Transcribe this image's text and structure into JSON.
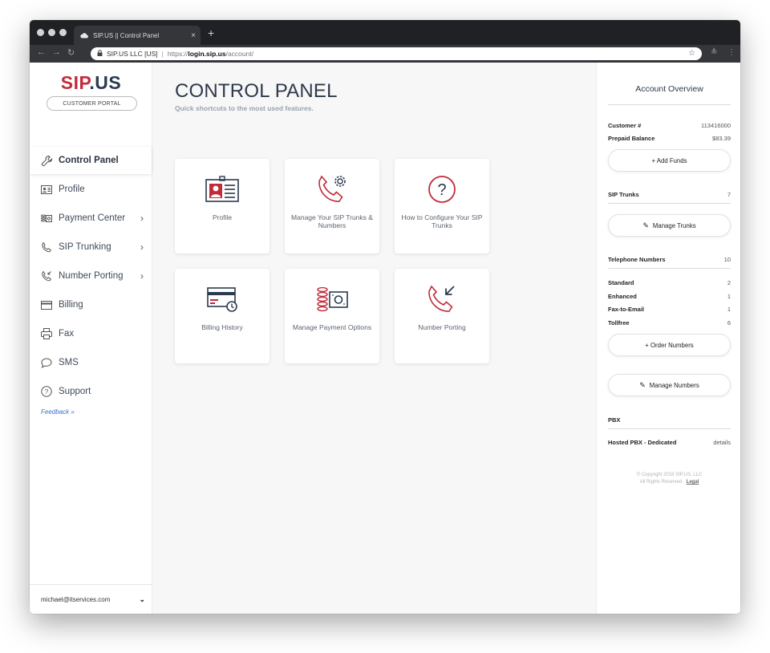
{
  "browser": {
    "tab_title": "SIP.US || Control Panel",
    "tab_close": "×",
    "new_tab": "+",
    "org": "SIP.US LLC [US]",
    "scheme": "https://",
    "host": "login.sip.us",
    "path": "/account/",
    "star": "☆"
  },
  "logo": {
    "part1": "SIP",
    "part2": ".US"
  },
  "portal_label": "CUSTOMER PORTAL",
  "sidebar": {
    "items": [
      {
        "label": "Control Panel",
        "icon": "wrench-icon",
        "active": true,
        "chevron": ""
      },
      {
        "label": "Profile",
        "icon": "id-card-icon",
        "active": false,
        "chevron": ""
      },
      {
        "label": "Payment Center",
        "icon": "payment-icon",
        "active": false,
        "chevron": "›"
      },
      {
        "label": "SIP Trunking",
        "icon": "phone-icon",
        "active": false,
        "chevron": "›"
      },
      {
        "label": "Number Porting",
        "icon": "phone-porting-icon",
        "active": false,
        "chevron": "›"
      },
      {
        "label": "Billing",
        "icon": "card-icon",
        "active": false,
        "chevron": ""
      },
      {
        "label": "Fax",
        "icon": "fax-icon",
        "active": false,
        "chevron": ""
      },
      {
        "label": "SMS",
        "icon": "chat-bubble-icon",
        "active": false,
        "chevron": ""
      },
      {
        "label": "Support",
        "icon": "help-circle-icon",
        "active": false,
        "chevron": ""
      }
    ],
    "feedback": "Feedback »",
    "user_email": "michael@itservices.com",
    "user_chevron": "⌄"
  },
  "main": {
    "title": "CONTROL PANEL",
    "subtitle": "Quick shortcuts to the most used features.",
    "cards": [
      {
        "label": "Profile",
        "icon": "profile-card-icon"
      },
      {
        "label": "Manage Your SIP Trunks & Numbers",
        "icon": "phone-gear-icon"
      },
      {
        "label": "How to Configure Your SIP Trunks",
        "icon": "question-circle-icon"
      },
      {
        "label": "Billing History",
        "icon": "billing-history-icon"
      },
      {
        "label": "Manage Payment Options",
        "icon": "money-icon"
      },
      {
        "label": "Number Porting",
        "icon": "phone-incoming-icon"
      }
    ]
  },
  "overview": {
    "title": "Account Overview",
    "customer_label": "Customer #",
    "customer_value": "113416000",
    "balance_label": "Prepaid Balance",
    "balance_value": "$83.39",
    "add_funds": "+ Add Funds",
    "trunks_label": "SIP Trunks",
    "trunks_value": "7",
    "manage_trunks": "Manage Trunks",
    "numbers_label": "Telephone Numbers",
    "numbers_value": "10",
    "number_types": [
      {
        "label": "Standard",
        "value": "2"
      },
      {
        "label": "Enhanced",
        "value": "1"
      },
      {
        "label": "Fax-to-Email",
        "value": "1"
      },
      {
        "label": "Tollfree",
        "value": "6"
      }
    ],
    "order_numbers": "+ Order Numbers",
    "manage_numbers": "Manage Numbers",
    "pbx_label": "PBX",
    "pbx_item": "Hosted PBX - Dedicated",
    "pbx_details": "details",
    "copyright": "© Copyright 2018 SIP.US, LLC",
    "rights": "All Rights Reserved - ",
    "legal": "Legal"
  },
  "colors": {
    "brand_red": "#c22b3a",
    "brand_navy": "#2b3a4f",
    "link_blue": "#3a74c8"
  }
}
